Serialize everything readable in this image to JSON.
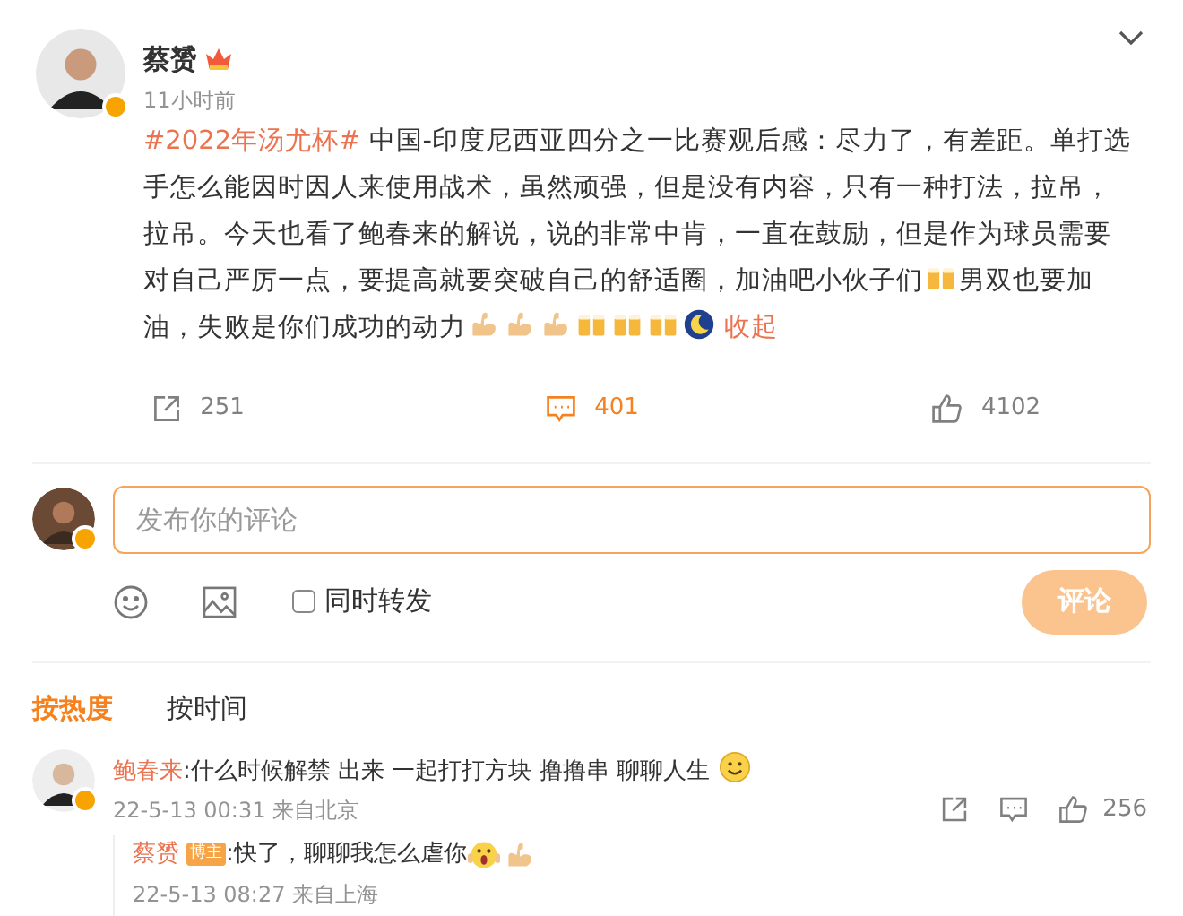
{
  "post": {
    "author": "蔡赟",
    "time": "11小时前",
    "verified": true,
    "segments": [
      {
        "kind": "hashtag",
        "text": "#2022年汤尤杯#"
      },
      {
        "kind": "text",
        "text": " 中国-印度尼西亚四分之一比赛观后感：尽力了，有差距。单打选手怎么能因时因人来使用战术，虽然顽强，但是没有内容，只有一种打法，拉吊，拉吊。今天也看了鲍春来的解说，说的非常中肯，一直在鼓励，但是作为球员需要对自己严厉一点，要提高就要突破自己的舒适圈，加油吧小伙子们"
      },
      {
        "kind": "beer"
      },
      {
        "kind": "text",
        "text": "男双也要加油，失败是你们成功的动力"
      },
      {
        "kind": "muscle"
      },
      {
        "kind": "muscle"
      },
      {
        "kind": "muscle"
      },
      {
        "kind": "beer"
      },
      {
        "kind": "beer"
      },
      {
        "kind": "beer"
      },
      {
        "kind": "moon"
      },
      {
        "kind": "link",
        "text": "收起"
      }
    ],
    "actions": [
      {
        "kind": "repost",
        "count": "251",
        "selected": false
      },
      {
        "kind": "comment",
        "count": "401",
        "selected": true
      },
      {
        "kind": "like",
        "count": "4102",
        "selected": false
      }
    ]
  },
  "composer": {
    "placeholder": "发布你的评论",
    "repost": {
      "label": "同时转发",
      "checked": false
    },
    "submit": {
      "label": "评论",
      "disabled": true
    }
  },
  "sort_tabs": [
    {
      "label": "按热度",
      "selected": true
    },
    {
      "label": "按时间",
      "selected": false
    }
  ],
  "comments": [
    {
      "author": "鲍春来",
      "verified": true,
      "segments": [
        {
          "kind": "text",
          "text": ":什么时候解禁 出来 一起打打方块 撸撸串 聊聊人生 "
        },
        {
          "kind": "smile"
        }
      ],
      "meta": "22-5-13 00:31 来自北京",
      "like_count": "256",
      "replies": [
        {
          "author": "蔡赟",
          "badge": "博主",
          "segments": [
            {
              "kind": "text",
              "text": ":快了，聊聊我怎么虐你"
            },
            {
              "kind": "scream"
            },
            {
              "kind": "muscle"
            }
          ],
          "meta": "22-5-13 08:27 来自上海"
        }
      ]
    }
  ]
}
